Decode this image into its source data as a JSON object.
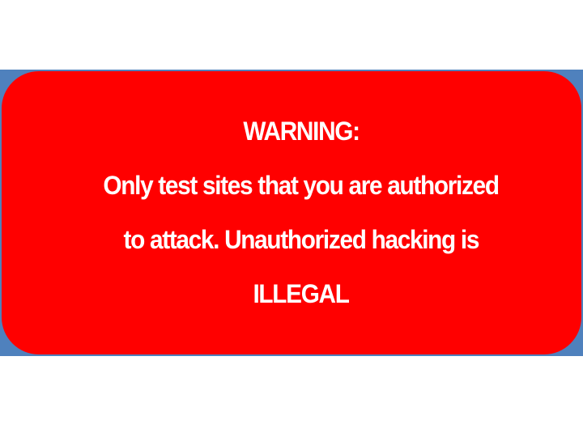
{
  "warning": {
    "lines": [
      "WARNING:",
      "Only test sites that you are authorized",
      "to attack. Unauthorized hacking is",
      "ILLEGAL"
    ]
  },
  "colors": {
    "background": "#ffffff",
    "backplate": "#4f81bd",
    "card": "#ff0000",
    "text": "#ffffff"
  }
}
